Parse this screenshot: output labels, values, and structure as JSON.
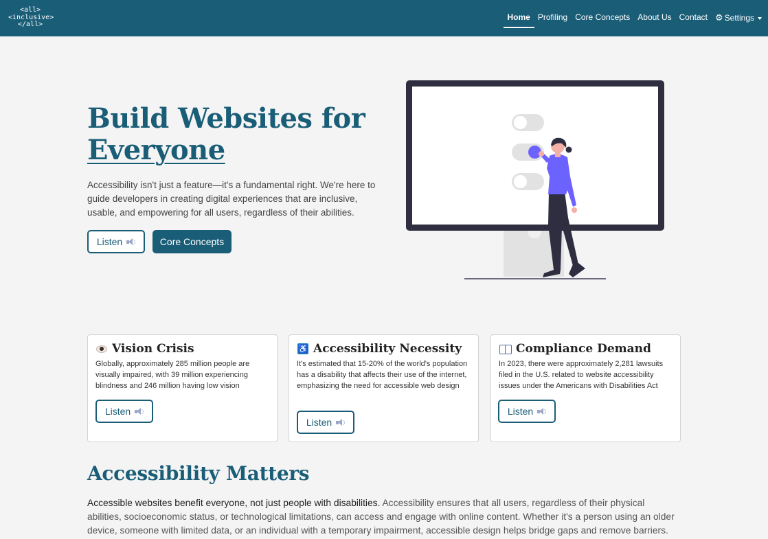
{
  "logo": {
    "line1": "<all>",
    "line2": "<inclusive>",
    "line3": "</all>"
  },
  "nav": {
    "items": [
      {
        "label": "Home",
        "active": true
      },
      {
        "label": "Profiling"
      },
      {
        "label": "Core Concepts"
      },
      {
        "label": "About Us"
      },
      {
        "label": "Contact"
      }
    ],
    "settings_label": "Settings",
    "settings_icon": "gear-icon"
  },
  "hero": {
    "title_line1": "Build Websites for",
    "title_line2": "Everyone",
    "description": "Accessibility isn't just a feature—it's a fundamental right. We're here to guide developers in creating digital experiences that are inclusive, usable, and empowering for all users, regardless of their abilities.",
    "listen_label": "Listen",
    "cta_label": "Core Concepts"
  },
  "cards": [
    {
      "icon": "eye-icon",
      "title": "Vision Crisis",
      "text": "Globally, approximately 285 million people are visually impaired, with 39 million experiencing blindness and 246 million having low vision",
      "listen_label": "Listen"
    },
    {
      "icon": "wheelchair-icon",
      "title": "Accessibility Necessity",
      "text": "It's estimated that 15-20% of the world's population has a disability that affects their use of the internet, emphasizing the need for accessible web design",
      "listen_label": "Listen"
    },
    {
      "icon": "book-icon",
      "title": "Compliance Demand",
      "text": "In 2023, there were approximately 2,281 lawsuits filed in the U.S. related to website accessibility issues under the Americans with Disabilities Act",
      "listen_label": "Listen"
    }
  ],
  "matters": {
    "title": "Accessibility Matters",
    "lead": "Accessible websites benefit everyone, not just people with disabilities.",
    "body": " Accessibility ensures that all users, regardless of their physical abilities, socioeconomic status, or technological limitations, can access and engage with online content. Whether it's a person using an older device, someone with limited data, or an individual with a temporary impairment, accessible design helps bridge gaps and remove barriers. It's about"
  },
  "colors": {
    "brand": "#1a5d77",
    "accent_purple": "#6c63ff",
    "background": "#f4f4f4"
  }
}
